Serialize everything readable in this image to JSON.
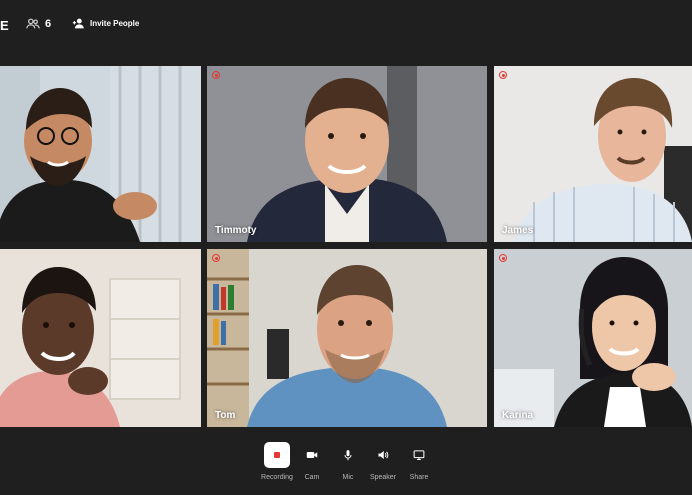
{
  "header": {
    "brand_fragment": "E",
    "participants_count": "6",
    "invite_label": "Invite People"
  },
  "tiles": [
    {
      "name": "",
      "recording": false,
      "bg": "#cfd8de",
      "skin": "#c58a64",
      "hair": "#2b1e17",
      "shirt": "#1b1b1b"
    },
    {
      "name": "Timmoty",
      "recording": true,
      "bg": "#8f9196",
      "skin": "#e3b190",
      "hair": "#4a3020",
      "shirt": "#23283a"
    },
    {
      "name": "James",
      "recording": true,
      "bg": "#e9e8e6",
      "skin": "#e7b69b",
      "hair": "#6a4a2f",
      "shirt": "#dfe7f0"
    },
    {
      "name": "",
      "recording": false,
      "bg": "#e8e2da",
      "skin": "#5b3a29",
      "hair": "#1c1410",
      "shirt": "#e39b94"
    },
    {
      "name": "Tom",
      "recording": true,
      "bg": "#d9d6d0",
      "skin": "#dca284",
      "hair": "#5e4330",
      "shirt": "#5f92c0"
    },
    {
      "name": "Karina",
      "recording": true,
      "bg": "#c9cfd2",
      "skin": "#eec6a8",
      "hair": "#17141a",
      "shirt": "#1a1a1a"
    }
  ],
  "controls": {
    "recording_label": "Recording",
    "cam_label": "Cam",
    "mic_label": "Mic",
    "speaker_label": "Speaker",
    "share_label": "Share"
  },
  "colors": {
    "background": "#1f1f1f",
    "record_red": "#e53935",
    "label_gray": "#b8b8b8"
  }
}
